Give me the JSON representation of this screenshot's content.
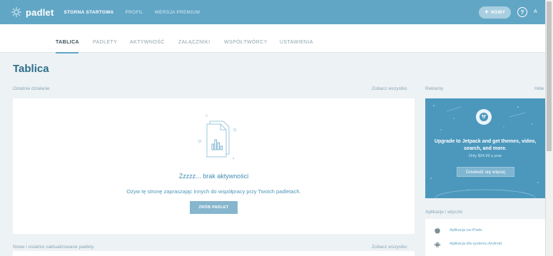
{
  "topbar": {
    "logo_text": "padlet",
    "nav": [
      {
        "label": "STORNA STARTOWA",
        "active": true
      },
      {
        "label": "PROFIL",
        "active": false
      },
      {
        "label": "WERSJA PREMIUM",
        "active": false
      }
    ],
    "new_button_label": "NOWY",
    "help_label": "?",
    "avatar_label": "A",
    "bar_color": "#62a6c6"
  },
  "tabs": [
    {
      "label": "TABLICA",
      "active": true
    },
    {
      "label": "PADLETY",
      "active": false
    },
    {
      "label": "AKTYWNOŚĆ",
      "active": false
    },
    {
      "label": "ZAŁĄCZNIKI",
      "active": false
    },
    {
      "label": "WSPÓŁTWÓRCY",
      "active": false
    },
    {
      "label": "USTAWIENIA",
      "active": false
    }
  ],
  "page_title": "Tablica",
  "recent": {
    "label": "Ostatnie działanie",
    "see_all": "Zobacz wszystko",
    "empty_title": "Zzzzz... brak aktywności",
    "empty_desc": "Ożyw tę stronę zapraszając innych do współpracy przy Twoich padletach.",
    "make_button": "ZRÓB PADLET"
  },
  "updated": {
    "label": "Nowe i ostatnio zaktualizowane padlety",
    "see_all": "Zobacz wszystko"
  },
  "ads": {
    "label": "Reklamy",
    "hide": "Hide",
    "headline": "Upgrade to Jetpack and get themes, video, search, and more.",
    "price": "Only $34.99 a year",
    "button": "Dowiedz się więcej",
    "background": "#4c98bd"
  },
  "apps": {
    "label": "Aplikacje i wtyczki",
    "items": [
      {
        "icon": "apple-icon",
        "label": "Aplikacja na iPada"
      },
      {
        "icon": "android-icon",
        "label": "Aplikacja dla systemu Android"
      }
    ]
  }
}
